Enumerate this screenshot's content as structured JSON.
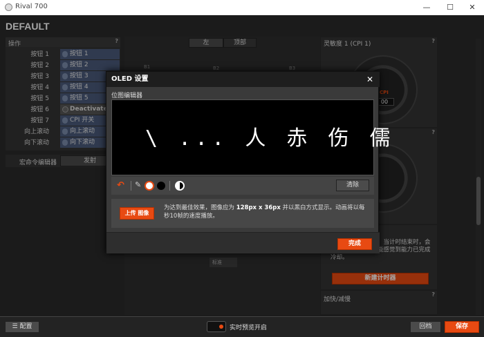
{
  "window": {
    "title": "Rival 700",
    "min": "—",
    "max": "☐",
    "close": "✕"
  },
  "profile": {
    "title": "DEFAULT"
  },
  "actions": {
    "header": "操作",
    "help": "?",
    "rows": [
      {
        "label": "按钮 1",
        "value": "按钮 1"
      },
      {
        "label": "按钮 2",
        "value": "按钮 2"
      },
      {
        "label": "按钮 3",
        "value": "按钮 3"
      },
      {
        "label": "按钮 4",
        "value": "按钮 4"
      },
      {
        "label": "按钮 5",
        "value": "按钮 5"
      },
      {
        "label": "按钮 6",
        "value": "Deactivated"
      },
      {
        "label": "按钮 7",
        "value": "CPI 开关"
      },
      {
        "label": "向上滚动",
        "value": "向上滚动"
      },
      {
        "label": "向下滚动",
        "value": "向下滚动"
      }
    ],
    "macro_label": "宏命令编辑器",
    "macro_button": "发射"
  },
  "view_tabs": {
    "left": "左",
    "top": "顶部"
  },
  "mouse_labels": {
    "b1": "B1",
    "b2": "B2",
    "b3": "B3",
    "bottom": "标准"
  },
  "sensitivity": {
    "header": "灵敏度 1 (CPI 1)",
    "cpi_label": "CPI",
    "cpi_value": "00"
  },
  "tactile": {
    "text": "系鼠标按键来触发，当计时结束时，会以触觉提示，让你能感觉到能力已完成冷却。",
    "button": "新建计时器"
  },
  "accel": {
    "header": "加快/减慢"
  },
  "modal": {
    "title": "OLED 设置",
    "close": "✕",
    "subtitle": "位图编辑器",
    "clear_button": "清除",
    "upload_button": "上传 图像",
    "info_prefix": "为达到最佳效果，图像应为 ",
    "info_size": "128px x 36px",
    "info_suffix": " 并以黑白方式显示。动画将以每秒10帧的速度播放。",
    "done_button": "完成",
    "oled_text": "\\ ... 人 赤 伤 儒"
  },
  "bottom": {
    "config_button": "配置",
    "live_preview": "实时预览开启",
    "revert_button": "回档",
    "save_button": "保存"
  },
  "colors": {
    "accent": "#e84a12",
    "select_blue": "#4a5a7a"
  }
}
